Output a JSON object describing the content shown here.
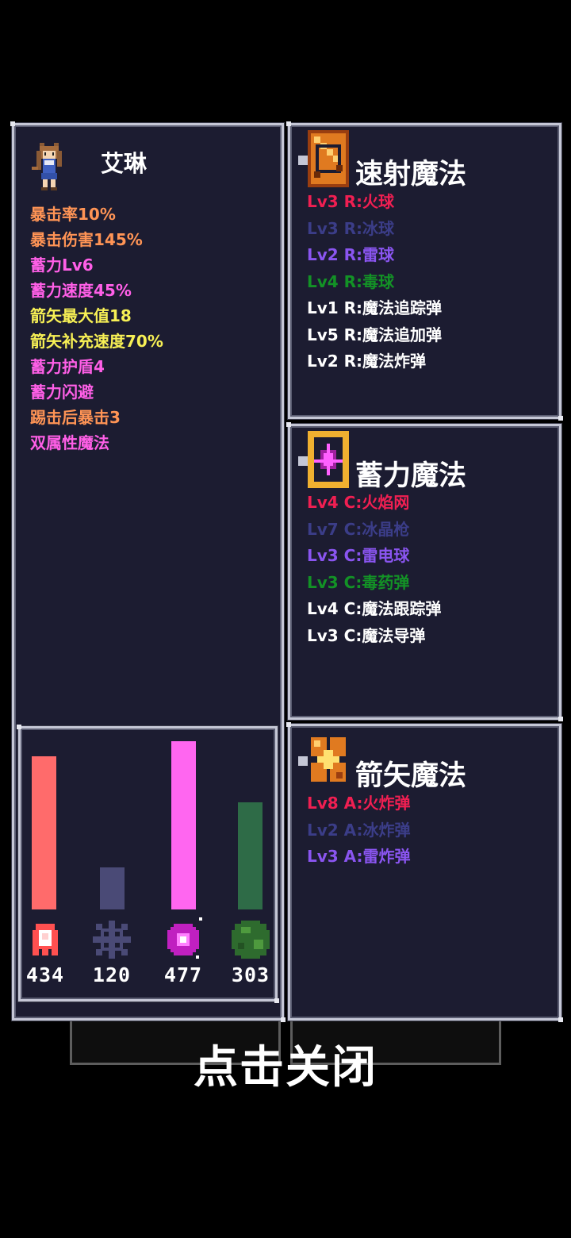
{
  "character": {
    "name": "艾琳",
    "stats": [
      {
        "label": "暴击率10%",
        "color": "#ff9455"
      },
      {
        "label": "暴击伤害145%",
        "color": "#ff9455"
      },
      {
        "label": "蓄力Lv6",
        "color": "#ff5fe7"
      },
      {
        "label": "蓄力速度45%",
        "color": "#ff5fe7"
      },
      {
        "label": "箭矢最大值18",
        "color": "#f7f055"
      },
      {
        "label": "箭矢补充速度70%",
        "color": "#f7f055"
      },
      {
        "label": "蓄力护盾4",
        "color": "#ff5fe7"
      },
      {
        "label": "蓄力闪避",
        "color": "#ff5fe7"
      },
      {
        "label": "踢击后暴击3",
        "color": "#ff9455"
      },
      {
        "label": "双属性魔法",
        "color": "#ff5fe7"
      }
    ]
  },
  "elements": {
    "chart_data": {
      "type": "bar",
      "categories": [
        "fire-icon",
        "ice-icon",
        "thunder-icon",
        "poison-icon"
      ],
      "values": [
        434,
        120,
        477,
        303
      ],
      "colors": [
        "#ff6b6b",
        "#4a4a76",
        "#ff66f0",
        "#2e6b47"
      ],
      "ylim": [
        0,
        477
      ]
    },
    "values_text": [
      "434",
      "120",
      "477",
      "303"
    ]
  },
  "rapid_magic": {
    "title": "速射魔法",
    "icon": "rapid-magic-icon",
    "items": [
      {
        "text": "Lv3 R:火球",
        "color": "#f01f52"
      },
      {
        "text": "Lv3 R:冰球",
        "color": "#3b3d88"
      },
      {
        "text": "Lv2 R:雷球",
        "color": "#8a55f0"
      },
      {
        "text": "Lv4 R:毒球",
        "color": "#139226"
      },
      {
        "text": "Lv1 R:魔法追踪弹",
        "color": "#ffffff"
      },
      {
        "text": "Lv5 R:魔法追加弹",
        "color": "#ffffff"
      },
      {
        "text": "Lv2 R:魔法炸弹",
        "color": "#ffffff"
      }
    ]
  },
  "charge_magic": {
    "title": "蓄力魔法",
    "icon": "charge-magic-icon",
    "items": [
      {
        "text": "Lv4 C:火焰网",
        "color": "#f01f52"
      },
      {
        "text": "Lv7 C:冰晶枪",
        "color": "#3b3d88"
      },
      {
        "text": "Lv3 C:雷电球",
        "color": "#8a55f0"
      },
      {
        "text": "Lv3 C:毒药弹",
        "color": "#139226"
      },
      {
        "text": "Lv4 C:魔法跟踪弹",
        "color": "#ffffff"
      },
      {
        "text": "Lv3 C:魔法导弹",
        "color": "#ffffff"
      }
    ]
  },
  "arrow_magic": {
    "title": "箭矢魔法",
    "icon": "arrow-magic-icon",
    "items": [
      {
        "text": "Lv8 A:火炸弹",
        "color": "#f01f52"
      },
      {
        "text": "Lv2 A:冰炸弹",
        "color": "#3b3d88"
      },
      {
        "text": "Lv3 A:雷炸弹",
        "color": "#8a55f0"
      }
    ]
  },
  "close_label": "点击关闭"
}
